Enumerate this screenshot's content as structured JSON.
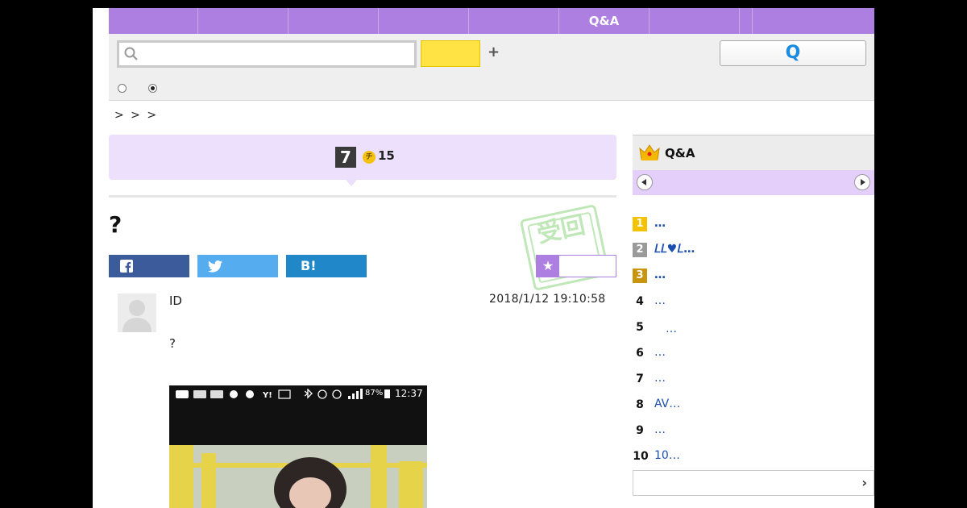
{
  "nav": {
    "tabs": [
      "",
      "",
      "",
      "",
      "",
      "Q&A",
      "",
      "",
      ""
    ]
  },
  "search": {
    "placeholder": "",
    "qa_label": "Q"
  },
  "breadcrumb": "> > >",
  "question": {
    "grade": "7",
    "coin_icon": "チ",
    "coins": "15",
    "title": "?",
    "stamp_text": "受回",
    "user_id": "ID",
    "date": "2018/1/12  19:10:58",
    "body": "?"
  },
  "share": {
    "facebook": "",
    "twitter": "",
    "hatena": "B!"
  },
  "attached_image": {
    "status_time": "12:37",
    "battery": "87%"
  },
  "sidebar": {
    "title": "Q&A",
    "ranking": [
      {
        "rank": "1",
        "text": "…"
      },
      {
        "rank": "2",
        "text": "𝐿𝐿♥𝐿…"
      },
      {
        "rank": "3",
        "text": "…"
      },
      {
        "rank": "4",
        "text": "…"
      },
      {
        "rank": "5",
        "text": "　…"
      },
      {
        "rank": "6",
        "text": "…"
      },
      {
        "rank": "7",
        "text": "…"
      },
      {
        "rank": "8",
        "text": "AV…"
      },
      {
        "rank": "9",
        "text": " …"
      },
      {
        "rank": "10",
        "text": "10…"
      }
    ]
  },
  "colors": {
    "accent": "#ad7fe0",
    "light_accent": "#ede0fc",
    "gold": "#f5c200",
    "silver": "#9a9a9a",
    "bronze": "#c9950c"
  }
}
